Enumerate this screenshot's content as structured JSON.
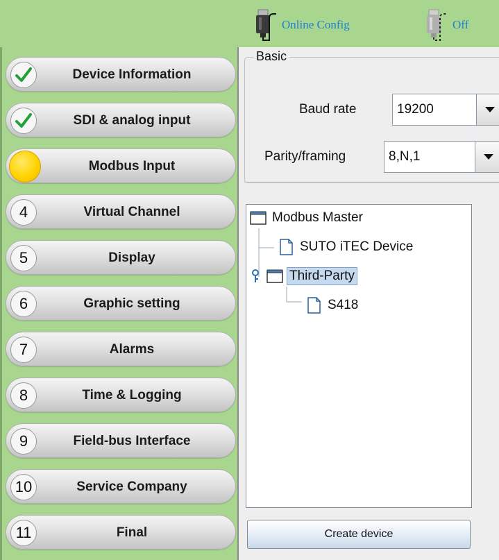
{
  "toolbar": {
    "online_label": "Online Config",
    "offline_label": "Off",
    "online_icon": "usb-plug-connected-icon",
    "offline_icon": "usb-plug-disconnected-icon"
  },
  "nav": {
    "items": [
      {
        "badge": "",
        "state": "done",
        "label": "Device Information"
      },
      {
        "badge": "",
        "state": "done",
        "label": "SDI & analog input"
      },
      {
        "badge": "",
        "state": "active",
        "label": "Modbus Input"
      },
      {
        "badge": "4",
        "state": "pending",
        "label": "Virtual Channel"
      },
      {
        "badge": "5",
        "state": "pending",
        "label": "Display"
      },
      {
        "badge": "6",
        "state": "pending",
        "label": "Graphic setting"
      },
      {
        "badge": "7",
        "state": "pending",
        "label": "Alarms"
      },
      {
        "badge": "8",
        "state": "pending",
        "label": "Time & Logging"
      },
      {
        "badge": "9",
        "state": "pending",
        "label": "Field-bus Interface"
      },
      {
        "badge": "10",
        "state": "pending",
        "label": "Service Company"
      },
      {
        "badge": "11",
        "state": "pending",
        "label": "Final"
      }
    ]
  },
  "basic": {
    "legend": "Basic",
    "baud_label": "Baud rate",
    "baud_value": "19200",
    "parity_label": "Parity/framing",
    "parity_value": "8,N,1"
  },
  "tree": {
    "root": "Modbus Master",
    "nodes": [
      {
        "label": "SUTO iTEC Device"
      },
      {
        "label": "Third-Party"
      },
      {
        "label": "S418"
      }
    ]
  },
  "create_button": "Create device",
  "colors": {
    "background_green": "#a8d68f",
    "link_blue": "#1f7fd0",
    "check_green": "#22a03a",
    "active_yellow": "#ffd400",
    "selection_blue": "#c5d9ef"
  }
}
